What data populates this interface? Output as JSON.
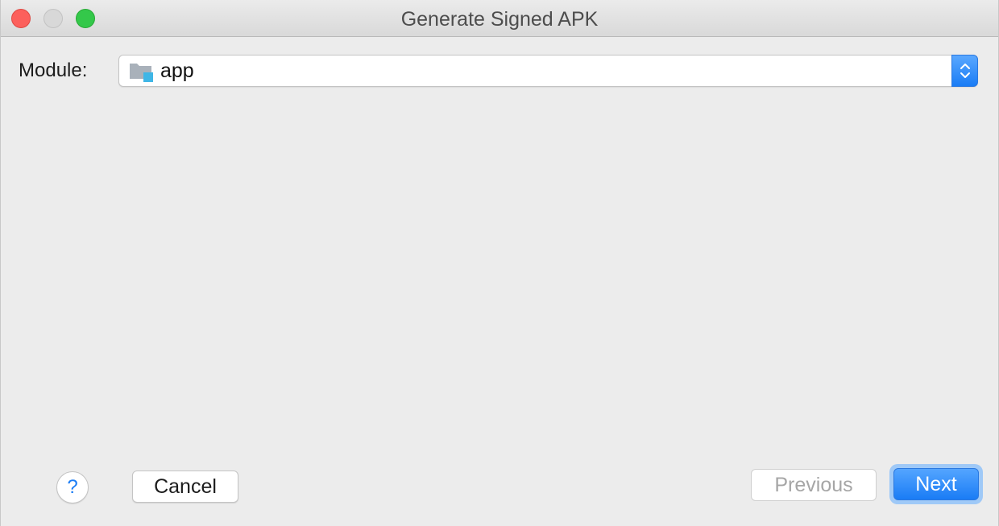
{
  "window": {
    "title": "Generate Signed APK"
  },
  "form": {
    "module_label": "Module:",
    "module_value": "app",
    "module_icon": "folder-module-icon"
  },
  "buttons": {
    "help_label": "?",
    "cancel_label": "Cancel",
    "previous_label": "Previous",
    "next_label": "Next"
  },
  "colors": {
    "accent": "#1a7cf5",
    "close": "#fc605c",
    "minimize": "#d8d8d8",
    "zoom": "#34c84a",
    "disabled_text": "#a6a6a6"
  }
}
